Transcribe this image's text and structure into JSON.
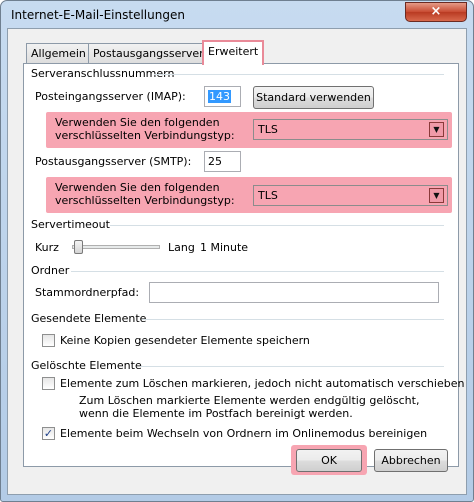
{
  "window": {
    "title": "Internet-E-Mail-Einstellungen",
    "close_glyph": "×"
  },
  "tabs": [
    {
      "label": "Allgemein",
      "active": false
    },
    {
      "label": "Postausgangsserver",
      "active": false
    },
    {
      "label": "Erweitert",
      "active": true
    }
  ],
  "server_ports": {
    "group_label": "Serveranschlussnummern",
    "imap_label": "Posteingangsserver (IMAP):",
    "imap_value": "143",
    "default_button": "Standard verwenden",
    "encryption_label_1": "Verwenden Sie den folgenden verschlüsselten Verbindungstyp:",
    "encryption_value_1": "TLS",
    "smtp_label": "Postausgangsserver (SMTP):",
    "smtp_value": "25",
    "encryption_label_2": "Verwenden Sie den folgenden verschlüsselten Verbindungstyp:",
    "encryption_value_2": "TLS"
  },
  "timeout": {
    "group_label": "Servertimeout",
    "short_label": "Kurz",
    "long_label": "Lang",
    "value_text": "1 Minute",
    "slider_level": 0.0
  },
  "folders": {
    "group_label": "Ordner",
    "root_label": "Stammordnerpfad:",
    "root_value": ""
  },
  "sent_items": {
    "group_label": "Gesendete Elemente",
    "no_copies_label": "Keine Kopien gesendeter Elemente speichern",
    "no_copies_checked": false
  },
  "deleted_items": {
    "group_label": "Gelöschte Elemente",
    "mark_label": "Elemente zum Löschen markieren, jedoch nicht automatisch verschieben",
    "mark_checked": false,
    "mark_note": "Zum Löschen markierte Elemente werden endgültig gelöscht, wenn die Elemente im Postfach bereinigt werden.",
    "purge_label": "Elemente beim Wechseln von Ordnern im Onlinemodus bereinigen",
    "purge_checked": true,
    "check_glyph": "✓"
  },
  "footer": {
    "ok_label": "OK",
    "cancel_label": "Abbrechen"
  },
  "icons": {
    "dropdown_glyph": "▼"
  }
}
